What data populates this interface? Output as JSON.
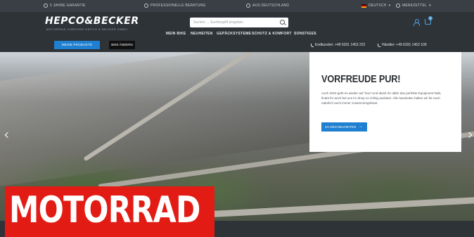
{
  "topbar": {
    "warranty": "5 JAHRE GARANTIE",
    "consulting": "PROFESSIONELLE BERATUNG",
    "made_in": "AUS DEUTSCHLAND",
    "language": "DEUTSCH",
    "watchlist": "MERKZETTEL"
  },
  "header": {
    "logo": "HEPCO&BECKER",
    "logo_sub": "MOTORRAD ZUBEHÖR HEPCO & BECKER GMBH",
    "search_placeholder": "Suchen ... Suchbegriff eingeben",
    "cart_count": "0"
  },
  "nav": {
    "items": [
      "MEIN BIKE",
      "NEUHEITEN",
      "GEPÄCKSYSTEME",
      "SCHUTZ & KOMFORT",
      "SONSTIGES"
    ]
  },
  "strip": {
    "primary_button": "MEINE PRODUKTE ANZEIGEN",
    "secondary_button": "BIKE ÄNDERN",
    "phone_consumer": "Endkunden: +49 6331 1453 222",
    "phone_dealer": "Händler: +49 6331 1453 109"
  },
  "hero_card": {
    "title": "VORFREUDE PUR!",
    "text": "Auch 2023 geht es wieder auf Tour! Und damit Ihr dafür das perfekte Equipment habt, findet ihr auch bei uns im Shop so richtig auslöten. Alle Neuheiten halten wir für euch natürlich auch immer zusammengefasst.",
    "button": "ZU DEN NEUHEITEN"
  },
  "magazine_brand": "MOTORRAD",
  "colors": {
    "accent_blue": "#1f7fd0",
    "header_bg": "#2e3338",
    "brand_red": "#e21b14"
  }
}
